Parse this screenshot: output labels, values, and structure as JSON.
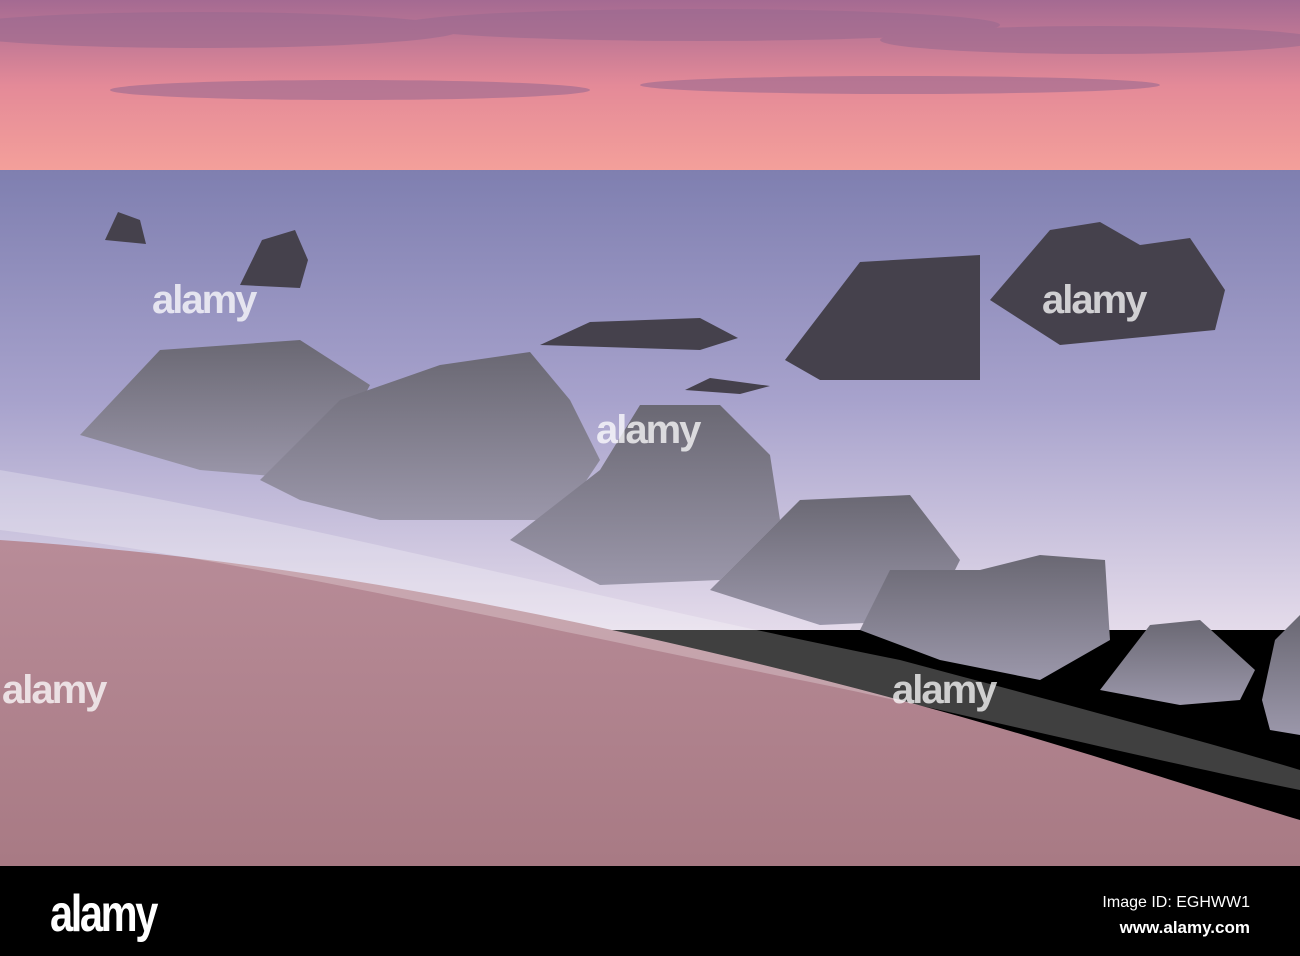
{
  "photo": {
    "subject": "rocks",
    "colors": {
      "sky_top": "#b96f8e",
      "sky_bottom": "#f39a96",
      "sea": "#8f86b8",
      "sand": "#b58790",
      "rock": "#4a4550"
    }
  },
  "watermark": {
    "text": "alamy"
  },
  "footer": {
    "logo": "alamy",
    "image_id": "Image ID: EGHWW1",
    "website": "www.alamy.com"
  }
}
